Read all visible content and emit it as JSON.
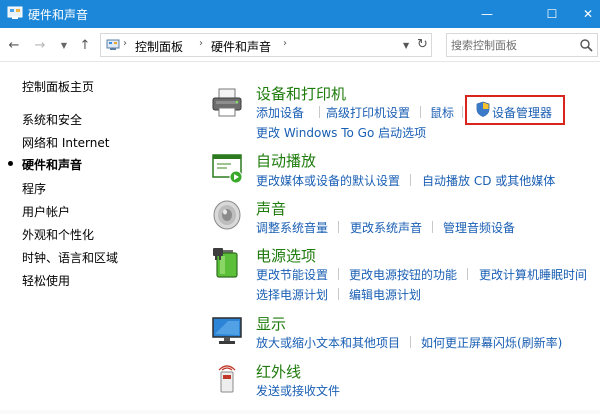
{
  "window": {
    "title": "硬件和声音",
    "minimize_glyph": "—",
    "maximize_glyph": "☐",
    "close_glyph": "✕"
  },
  "nav": {
    "back_glyph": "←",
    "forward_glyph": "→",
    "recent_glyph": "▼",
    "up_glyph": "↑"
  },
  "address": {
    "sep_glyph": "›",
    "crumbs": [
      "控制面板",
      "硬件和声音"
    ],
    "dropdown_glyph": "▼",
    "refresh_glyph": "↻"
  },
  "search": {
    "placeholder": "搜索控制面板"
  },
  "sidebar": {
    "items": [
      {
        "label": "控制面板主页"
      },
      {
        "label": "系统和安全"
      },
      {
        "label": "网络和 Internet"
      },
      {
        "label": "硬件和声音",
        "current": true
      },
      {
        "label": "程序"
      },
      {
        "label": "用户帐户"
      },
      {
        "label": "外观和个性化"
      },
      {
        "label": "时钟、语言和区域"
      },
      {
        "label": "轻松使用"
      }
    ]
  },
  "categories": [
    {
      "title": "设备和打印机",
      "icon": "printer-icon",
      "links": [
        "添加设备",
        "高级打印机设置",
        "鼠标",
        "设备管理器",
        "更改 Windows To Go 启动选项"
      ]
    },
    {
      "title": "自动播放",
      "icon": "autoplay-icon",
      "links": [
        "更改媒体或设备的默认设置",
        "自动播放 CD 或其他媒体"
      ]
    },
    {
      "title": "声音",
      "icon": "speaker-icon",
      "links": [
        "调整系统音量",
        "更改系统声音",
        "管理音频设备"
      ]
    },
    {
      "title": "电源选项",
      "icon": "battery-icon",
      "links": [
        "更改节能设置",
        "更改电源按钮的功能",
        "更改计算机睡眠时间",
        "选择电源计划",
        "编辑电源计划"
      ]
    },
    {
      "title": "显示",
      "icon": "monitor-icon",
      "links": [
        "放大或缩小文本和其他项目",
        "如何更正屏幕闪烁(刷新率)"
      ]
    },
    {
      "title": "红外线",
      "icon": "infrared-icon",
      "links": [
        "发送或接收文件"
      ]
    }
  ],
  "colors": {
    "titlebar": "#1c87d9",
    "category_title": "#1e7b0c",
    "link": "#1a5fb4",
    "highlight_box": "#d9251d"
  }
}
